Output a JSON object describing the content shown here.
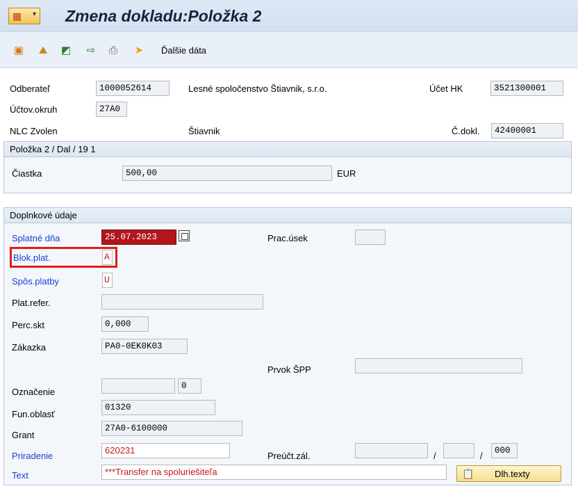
{
  "window": {
    "title": "Zmena dokladu:Položka 2",
    "menu_icon": "sap-menu-icon",
    "menu_arrow": "▾"
  },
  "toolbar": {
    "icons": [
      "create-icon",
      "display-icon",
      "back-icon",
      "forward-icon",
      "print-icon",
      "more-data-icon"
    ],
    "more_data_label": "Ďalšie dáta"
  },
  "header": {
    "odberatel_label": "Odberateľ",
    "odberatel_value": "1000052614",
    "odberatel_name": "Lesné spoločenstvo Štiavnik, s.r.o.",
    "ucet_hk_label": "Účet HK",
    "ucet_hk_value": "3521300001",
    "uctov_okruh_label": "Účtov.okruh",
    "uctov_okruh_value": "27A0",
    "city": "NLC Zvolen",
    "place": "Štiavnik",
    "c_dokl_label": "Č.dokl.",
    "c_dokl_value": "42400001"
  },
  "item_section": {
    "title": "Položka 2 / Dal / 19 1",
    "ciastka_label": "Čiastka",
    "ciastka_value": "500,00",
    "currency": "EUR"
  },
  "additional_section": {
    "title": "Doplnkové údaje",
    "splatne_dna_label": "Splatné dňa",
    "splatne_dna_value": "25.07.2023",
    "prac_usek_label": "Prac.úsek",
    "prac_usek_value": "",
    "blok_plat_label": "Blok.plat.",
    "blok_plat_value": "A",
    "sposob_platby_label": "Spôs.platby",
    "sposob_platby_value": "U",
    "plat_refer_label": "Plat.refer.",
    "plat_refer_value": "",
    "perc_skt_label": "Perc.skt",
    "perc_skt_value": "0,000",
    "zakazka_label": "Zákazka",
    "zakazka_value": "PA0-0EK0K03",
    "prvok_spp_label": "Prvok ŠPP",
    "prvok_spp_value": "",
    "oznacenie_label": "Označenie",
    "oznacenie_value": "",
    "oznacenie_number": "0",
    "fun_oblast_label": "Fun.oblasť",
    "fun_oblast_value": "01320",
    "grant_label": "Grant",
    "grant_value": "27A0-6100000",
    "priradenie_label": "Priradenie",
    "priradenie_value": "620231",
    "preuct_zal_label": "Preúčt.zál.",
    "preuct_zal_value1": "",
    "preuct_zal_value2": "",
    "preuct_zal_value3": "000",
    "slash": "/",
    "text_label": "Text",
    "text_value": "***Transfer na spoluriešiteľa",
    "dlh_texty_label": "Dlh.texty"
  }
}
